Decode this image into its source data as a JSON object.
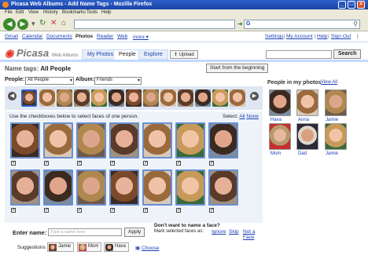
{
  "window": {
    "title": "Picasa Web Albums - Add Name Tags - Mozilla Firefox"
  },
  "menu": [
    "File",
    "Edit",
    "View",
    "History",
    "Bookmarks",
    "Tools",
    "Help"
  ],
  "gbar": {
    "left": [
      "Gmail",
      "Calendar",
      "Documents",
      "Photos",
      "Reader",
      "Web",
      "more ▾"
    ],
    "right": [
      "Settings",
      "My Account",
      "Help",
      "Sign Out"
    ]
  },
  "header": {
    "logo": "Picasa",
    "logo_sub": "Web Albums",
    "tabs": [
      "My Photos",
      "People",
      "Explore"
    ],
    "upload": "Upload",
    "search_button": "Search"
  },
  "page": {
    "title_prefix": "Name tags:",
    "title": "All People",
    "start_button": "Start from the beginning",
    "people_label": "People:",
    "people_value": "All People",
    "album_label": "Album:",
    "album_value": "Friends",
    "instructions": "Use the checkboxes below to select faces of one person.",
    "select_label": "Select:",
    "select_all": "All",
    "select_none": "None"
  },
  "form": {
    "enter_name_label": "Enter name:",
    "name_placeholder": "Type a name here",
    "apply": "Apply",
    "dont_want": "Don't want to name a face?",
    "mark_selected": "Mark selected faces as:",
    "ignore": "Ignore",
    "skip": "Skip",
    "not_a_face": "Not a Face",
    "suggestions_label": "Suggestions",
    "suggestions": [
      "Jamie",
      "Mom",
      "Hava"
    ],
    "choose": "Choose"
  },
  "sidebar": {
    "title": "People in my photos",
    "view_all": "View All",
    "people": [
      "Hava",
      "Anna",
      "Jamie",
      "Mom",
      "Dad",
      "Jamie"
    ]
  }
}
